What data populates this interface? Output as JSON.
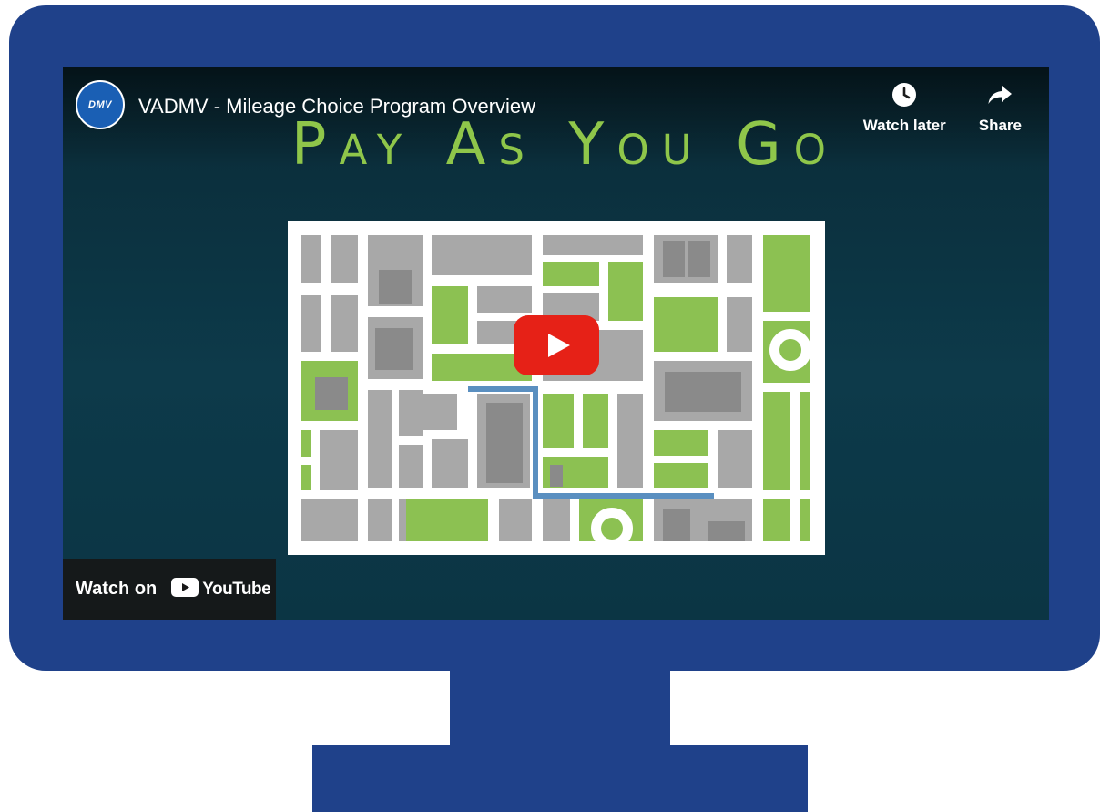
{
  "video": {
    "channel_avatar_text": "DMV",
    "title": "VADMV - Mileage Choice Program Overview",
    "headline": "Pay As You Go"
  },
  "actions": {
    "watch_later_label": "Watch later",
    "share_label": "Share",
    "watch_later_icon": "clock-icon",
    "share_icon": "share-arrow-icon"
  },
  "watch_on": {
    "label": "Watch on",
    "brand": "YouTube"
  },
  "colors": {
    "monitor_blue": "#1f418a",
    "headline_green": "#8fc64a",
    "play_red": "#e62117",
    "map_green": "#8cc152",
    "map_gray": "#a8a8a8",
    "route_blue": "#5a8fc0"
  }
}
